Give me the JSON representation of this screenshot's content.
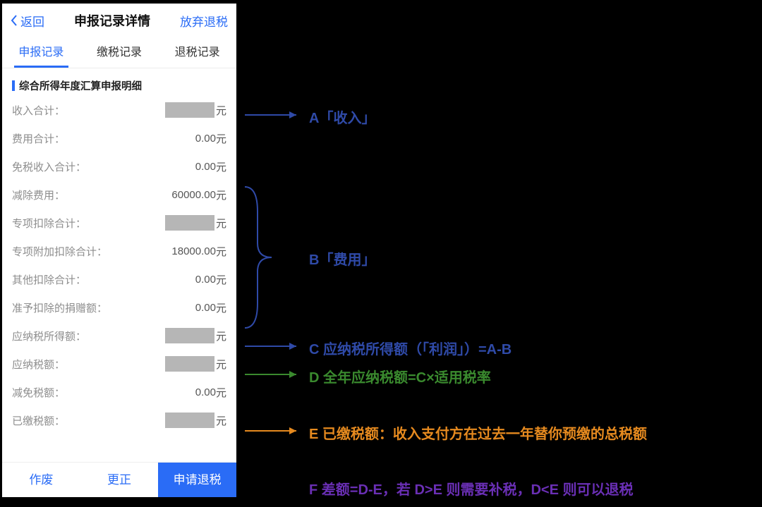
{
  "nav": {
    "back": "返回",
    "title": "申报记录详情",
    "abandon": "放弃退税"
  },
  "tabs": [
    "申报记录",
    "缴税记录",
    "退税记录"
  ],
  "activeTab": 0,
  "section": "综合所得年度汇算申报明细",
  "unit": "元",
  "rows": [
    {
      "label": "收入合计：",
      "value": "",
      "redacted": true
    },
    {
      "label": "费用合计：",
      "value": "0.00",
      "redacted": false
    },
    {
      "label": "免税收入合计：",
      "value": "0.00",
      "redacted": false
    },
    {
      "label": "减除费用：",
      "value": "60000.00",
      "redacted": false
    },
    {
      "label": "专项扣除合计：",
      "value": "",
      "redacted": true
    },
    {
      "label": "专项附加扣除合计：",
      "value": "18000.00",
      "redacted": false
    },
    {
      "label": "其他扣除合计：",
      "value": "0.00",
      "redacted": false
    },
    {
      "label": "准予扣除的捐赠额：",
      "value": "0.00",
      "redacted": false
    },
    {
      "label": "应纳税所得额：",
      "value": "",
      "redacted": true
    },
    {
      "label": "应纳税额：",
      "value": "",
      "redacted": true
    },
    {
      "label": "减免税额：",
      "value": "0.00",
      "redacted": false
    },
    {
      "label": "已缴税额：",
      "value": "",
      "redacted": true
    }
  ],
  "footer": {
    "void": "作废",
    "correct": "更正",
    "refund": "申请退税"
  },
  "annotations": {
    "A": {
      "text": "A「收入」",
      "color": "#2f4aa8"
    },
    "B": {
      "text": "B「费用」",
      "color": "#2f4aa8"
    },
    "C": {
      "text": "C 应纳税所得额（「利润」）=A-B",
      "color": "#2f4aa8"
    },
    "D": {
      "text": "D 全年应纳税额=C×适用税率",
      "color": "#3a8a2e"
    },
    "E": {
      "text": "E 已缴税额：收入支付方在过去一年替你预缴的总税额",
      "color": "#e68a1f"
    },
    "F": {
      "text": "F 差额=D-E，若 D>E 则需要补税，D<E 则可以退税",
      "color": "#6a2fb5"
    }
  }
}
